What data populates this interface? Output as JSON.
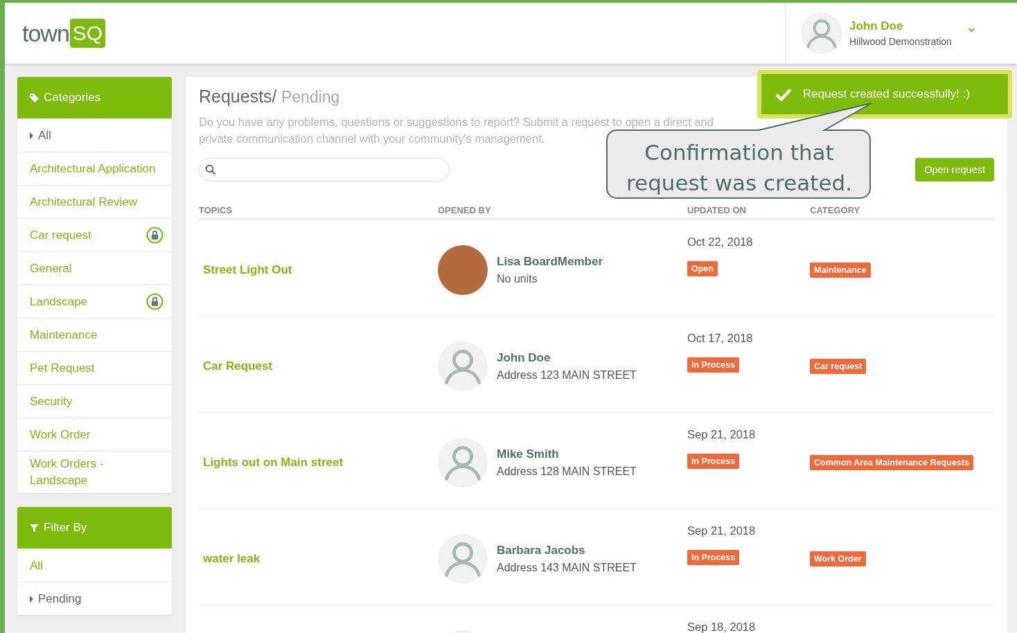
{
  "header": {
    "logo": {
      "left": "town",
      "right": "SQ"
    },
    "user": {
      "name": "John Doe",
      "community": "Hillwood Demonstration"
    }
  },
  "toast": {
    "message": "Request created successfully! :)"
  },
  "callout": {
    "text": "Confirmation that request was created."
  },
  "sidebar": {
    "categories": {
      "title": "Categories",
      "items": [
        {
          "label": "All",
          "selected": true,
          "locked": false
        },
        {
          "label": "Architectural Application",
          "selected": false,
          "locked": false
        },
        {
          "label": "Architectural Review",
          "selected": false,
          "locked": false
        },
        {
          "label": "Car request",
          "selected": false,
          "locked": true
        },
        {
          "label": "General",
          "selected": false,
          "locked": false
        },
        {
          "label": "Landscape",
          "selected": false,
          "locked": true
        },
        {
          "label": "Maintenance",
          "selected": false,
          "locked": false
        },
        {
          "label": "Pet Request",
          "selected": false,
          "locked": false
        },
        {
          "label": "Security",
          "selected": false,
          "locked": false
        },
        {
          "label": "Work Order",
          "selected": false,
          "locked": false
        },
        {
          "label": "Work Orders - Landscape",
          "selected": false,
          "locked": false
        }
      ]
    },
    "filter": {
      "title": "Filter By",
      "items": [
        {
          "label": "All",
          "selected": false
        },
        {
          "label": "Pending",
          "selected": true
        }
      ]
    }
  },
  "main": {
    "title": "Requests/",
    "subtitle": "Pending",
    "description": "Do you have any problems, questions or suggestions to report? Submit a request to open a direct and private communication channel with your community's management.",
    "open_button": "Open request",
    "table": {
      "columns": [
        "TOPICS",
        "OPENED BY",
        "UPDATED ON",
        "CATEGORY"
      ],
      "rows": [
        {
          "topic": "Street Light Out",
          "avatar": {
            "kind": "photo"
          },
          "name": "Lisa BoardMember",
          "address": "No units",
          "updated_on": "Oct 22, 2018",
          "status": "Open",
          "category": "Maintenance"
        },
        {
          "topic": "Car Request",
          "avatar": {
            "kind": "default"
          },
          "name": "John Doe",
          "address": "Address 123 MAIN STREET",
          "updated_on": "Oct 17, 2018",
          "status": "In Process",
          "category": "Car request"
        },
        {
          "topic": "Lights out on Main street",
          "avatar": {
            "kind": "default"
          },
          "name": "Mike Smith",
          "address": "Address 128 MAIN STREET",
          "updated_on": "Sep 21, 2018",
          "status": "In Process",
          "category": "Common Area Maintenance Requests"
        },
        {
          "topic": "water leak",
          "avatar": {
            "kind": "default"
          },
          "name": "Barbara Jacobs",
          "address": "Address 143 MAIN STREET",
          "updated_on": "Sep 21, 2018",
          "status": "In Process",
          "category": "Work Order"
        },
        {
          "avatar": {
            "kind": "default"
          },
          "updated_on": "Sep 18, 2018"
        }
      ]
    }
  }
}
